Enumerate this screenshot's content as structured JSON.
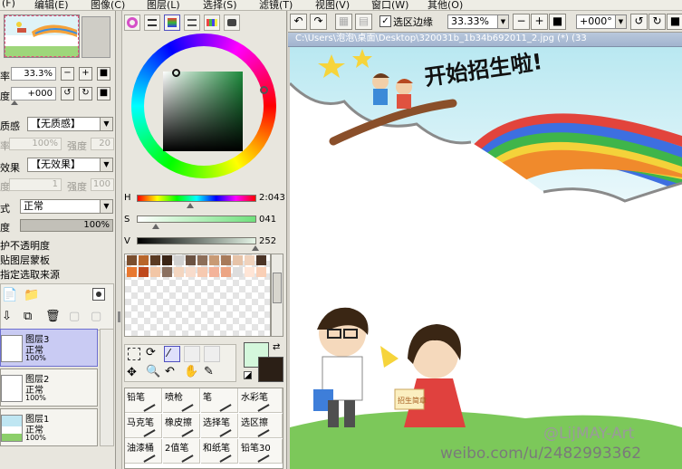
{
  "menubar": {
    "items": [
      "(F)",
      "编辑(E)",
      "图像(C)",
      "图层(L)",
      "选择(S)",
      "滤镜(T)",
      "视图(V)",
      "窗口(W)",
      "其他(O)"
    ]
  },
  "nav": {
    "zoom_label": "率",
    "zoom_value": "33.3%",
    "angle_label": "度",
    "angle_value": "+000"
  },
  "layer_props": {
    "texture_label": "质感",
    "texture_value": "【无质感】",
    "texture_amount": "100%",
    "texture_strength_label": "强度",
    "texture_strength": "20",
    "effect_label": "效果",
    "effect_value": "【无效果】",
    "effect_width": "1",
    "effect_strength_label": "强度",
    "effect_strength": "100",
    "mode_label": "式",
    "mode_value": "正常",
    "opacity_label": "度",
    "opacity_value": "100%",
    "opacity_fraction": 1.0,
    "check1": "护不透明度",
    "check2": "贴图层蒙板",
    "check3": "指定选取来源"
  },
  "layers": [
    {
      "name": "图层3",
      "mode": "正常",
      "opacity": "100%",
      "selected": true
    },
    {
      "name": "图层2",
      "mode": "正常",
      "opacity": "100%",
      "selected": false
    },
    {
      "name": "图层1",
      "mode": "正常",
      "opacity": "100%",
      "selected": false
    }
  ],
  "color": {
    "h_label": "H",
    "h_value": "2:043",
    "s_label": "S",
    "s_value": "041",
    "v_label": "V",
    "v_value": "252",
    "h_fraction": 0.45,
    "s_fraction": 0.16,
    "v_fraction": 0.99,
    "primary": "#d4f7dc",
    "secondary": "#2b1f16"
  },
  "swatches": [
    "#7a4e2e",
    "#b8652a",
    "#5a3a22",
    "#3a2415",
    "#d1d1d1",
    "#6b5242",
    "#8d6e58",
    "#c89a74",
    "#a77a5a",
    "#e6c3a8",
    "#f0d2bc",
    "#4b3426",
    "#e87830",
    "#bf4a1e",
    "#f2c6a6",
    "#8a7060",
    "#f4d6c0",
    "#f8dccc",
    "#f6c9b0",
    "#f3b39a",
    "#eca584",
    "#dddddd",
    "#ffe5d6",
    "#f9cfb6"
  ],
  "tools": [
    [
      "铅笔",
      "喷枪",
      "笔",
      "水彩笔"
    ],
    [
      "马克笔",
      "橡皮擦",
      "选择笔",
      "选区擦"
    ],
    [
      "油漆桶",
      "2值笔",
      "和纸笔",
      "铅笔30"
    ]
  ],
  "canvas_toolbar": {
    "selection_edge_label": "选区边缘",
    "zoom_value": "33.33%",
    "angle_value": "+000°"
  },
  "doc": {
    "title": "C:\\Users\\泡泡\\桌面\\Desktop\\320031b_1b34b692011_2.jpg (*) (33"
  },
  "artwork": {
    "headline": "开始招生啦!",
    "sign_text": "招生简章",
    "watermark_name": "@LijMAY-Art",
    "watermark_url": "weibo.com/u/2482993362"
  }
}
